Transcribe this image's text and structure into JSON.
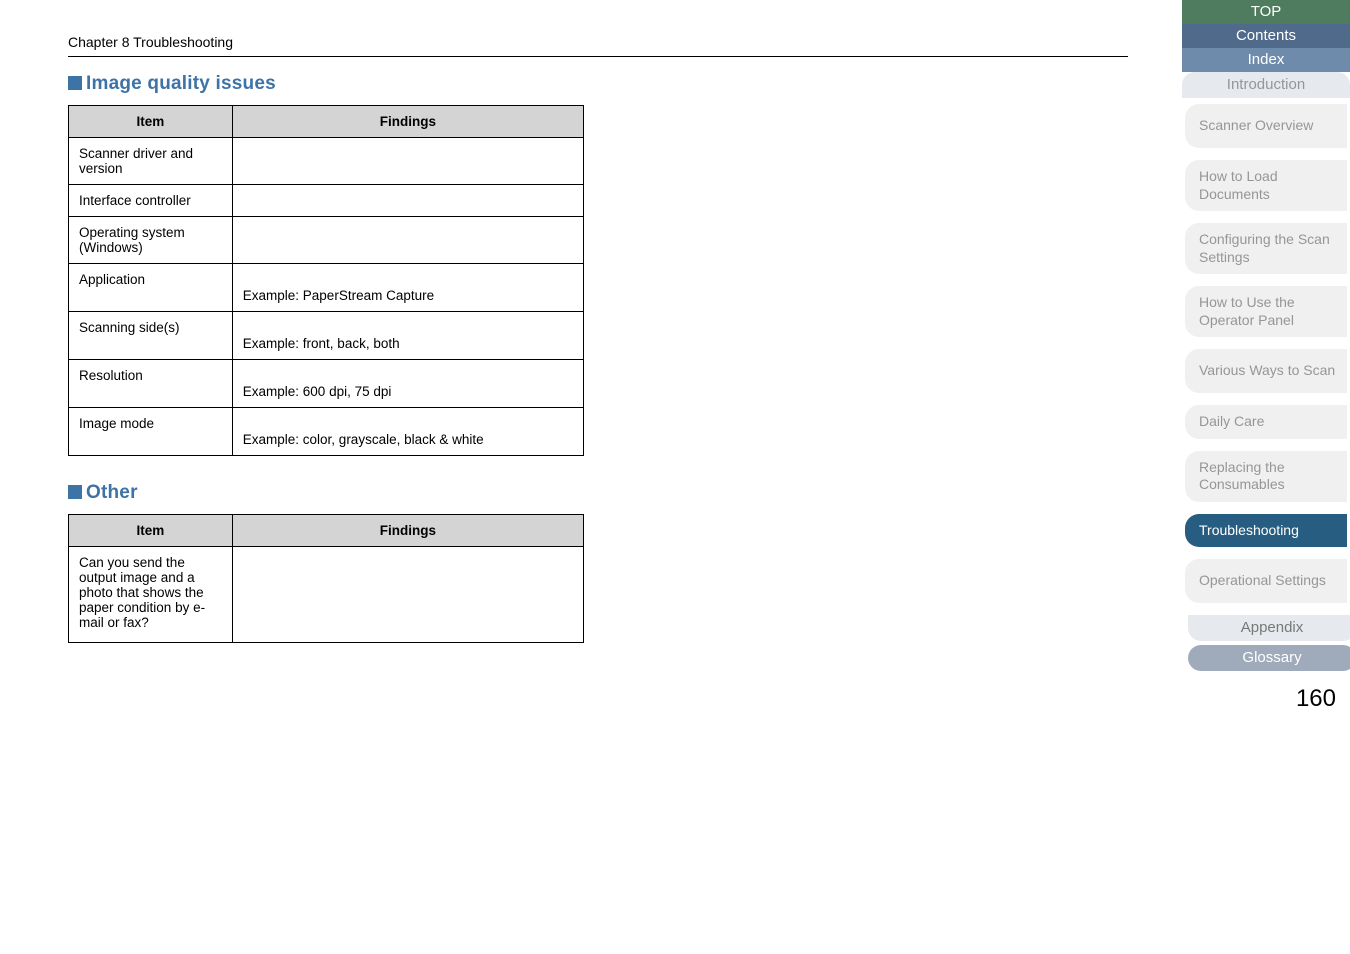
{
  "chapter": "Chapter 8 Troubleshooting",
  "sections": {
    "image_quality": {
      "title": "Image quality issues",
      "headers": {
        "item": "Item",
        "findings": "Findings"
      },
      "rows": [
        {
          "item": "Scanner driver and version",
          "findings": ""
        },
        {
          "item": "Interface controller",
          "findings": ""
        },
        {
          "item": "Operating system (Windows)",
          "findings": ""
        },
        {
          "item": "Application",
          "findings": "Example: PaperStream Capture"
        },
        {
          "item": "Scanning side(s)",
          "findings": "Example: front, back, both"
        },
        {
          "item": "Resolution",
          "findings": "Example: 600 dpi, 75 dpi"
        },
        {
          "item": "Image mode",
          "findings": "Example: color, grayscale, black & white"
        }
      ]
    },
    "other": {
      "title": "Other",
      "headers": {
        "item": "Item",
        "findings": "Findings"
      },
      "rows": [
        {
          "item": "Can you send the output image and a photo that shows the paper condition by e-mail or fax?",
          "findings": ""
        }
      ]
    }
  },
  "sidebar": {
    "top": "TOP",
    "contents": "Contents",
    "index": "Index",
    "intro": "Introduction",
    "nav": [
      {
        "label": "Scanner Overview"
      },
      {
        "label": "How to Load Documents"
      },
      {
        "label": "Configuring the Scan Settings"
      },
      {
        "label": "How to Use the Operator Panel"
      },
      {
        "label": "Various Ways to Scan"
      },
      {
        "label": "Daily Care"
      },
      {
        "label": "Replacing the Consumables"
      },
      {
        "label": "Troubleshooting",
        "active": true
      },
      {
        "label": "Operational Settings"
      }
    ],
    "appendix": "Appendix",
    "glossary": "Glossary"
  },
  "page_number": "160"
}
